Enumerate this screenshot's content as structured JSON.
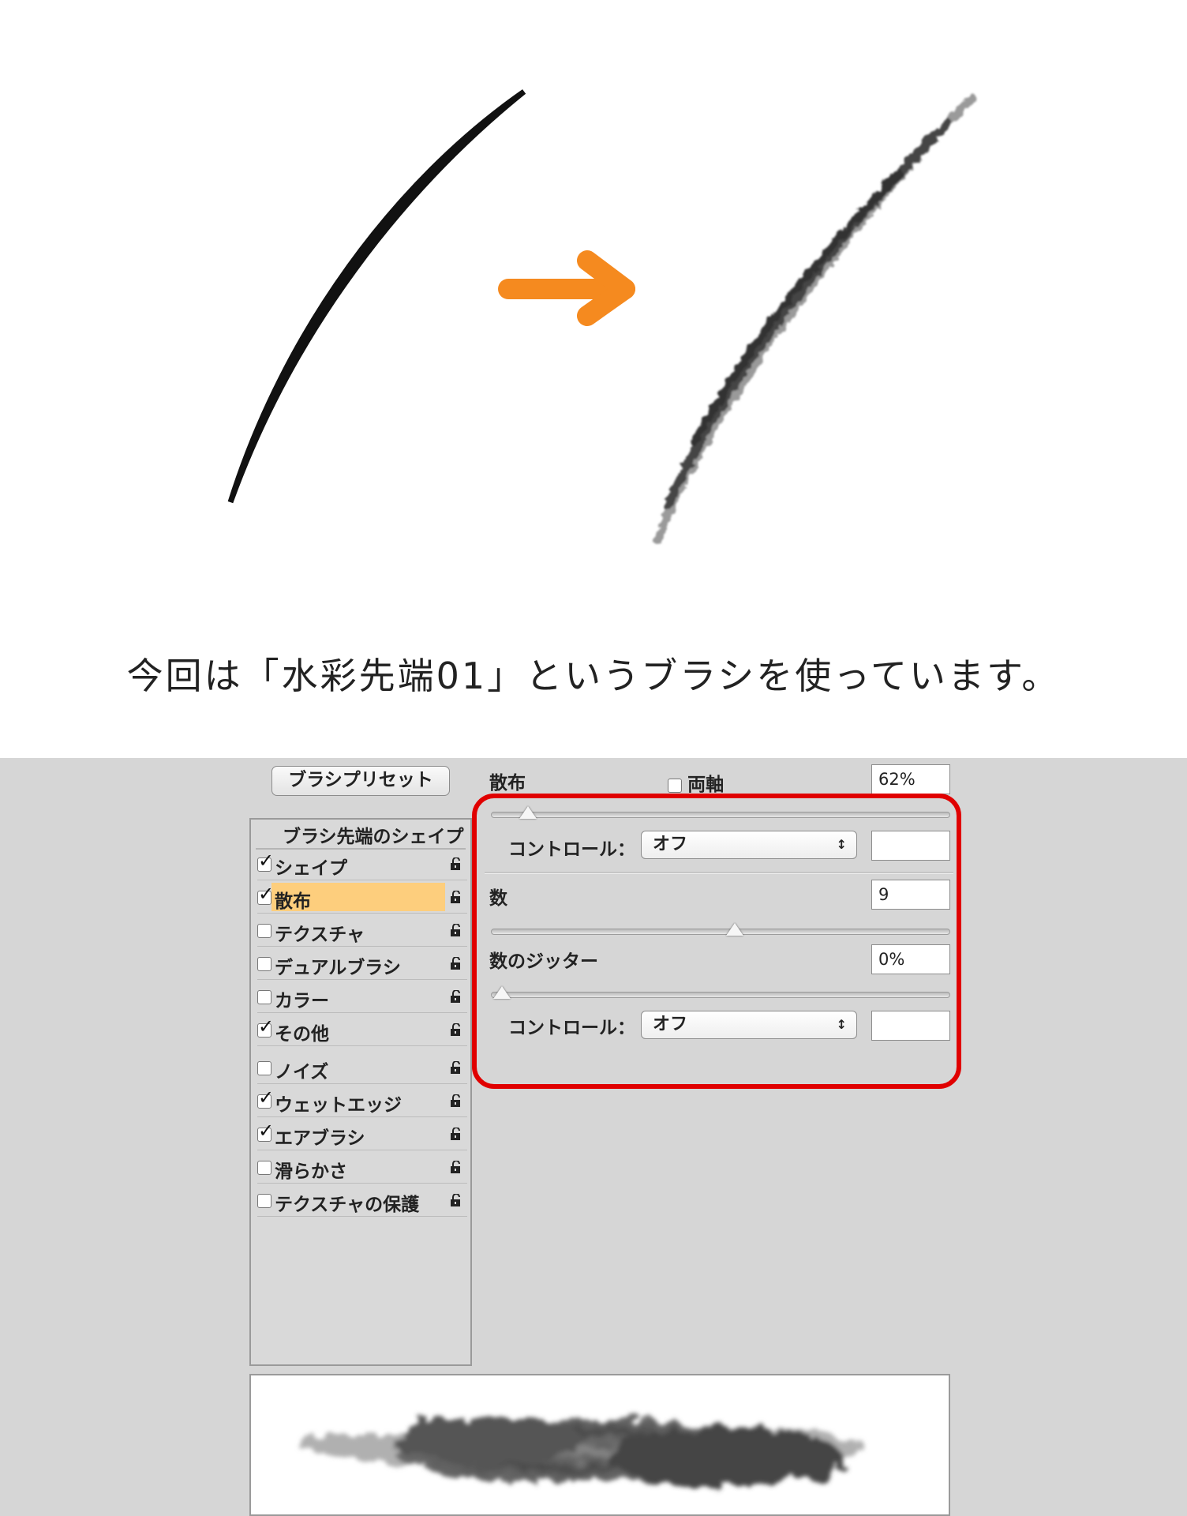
{
  "caption": "今回は「水彩先端01」というブラシを使っています。",
  "colors": {
    "arrow": "#f58a1f",
    "highlight": "#fdce7d",
    "callout": "#e00000",
    "panel_bg": "#d6d6d6"
  },
  "panel": {
    "preset_button": "ブラシプリセット",
    "list_header": "ブラシ先端のシェイプ",
    "items": [
      {
        "label": "シェイプ",
        "checked": true
      },
      {
        "label": "散布",
        "checked": true,
        "selected": true
      },
      {
        "label": "テクスチャ",
        "checked": false
      },
      {
        "label": "デュアルブラシ",
        "checked": false
      },
      {
        "label": "カラー",
        "checked": false
      },
      {
        "label": "その他",
        "checked": true
      },
      {
        "label": "ノイズ",
        "checked": false
      },
      {
        "label": "ウェットエッジ",
        "checked": true
      },
      {
        "label": "エアブラシ",
        "checked": true
      },
      {
        "label": "滑らかさ",
        "checked": false
      },
      {
        "label": "テクスチャの保護",
        "checked": false
      }
    ],
    "scatter": {
      "label": "散布",
      "both_axes_label": "両軸",
      "both_axes_checked": false,
      "value": "62%",
      "slider_fraction": 0.06
    },
    "control1": {
      "label": "コントロール：",
      "selected": "オフ",
      "value": ""
    },
    "count": {
      "label": "数",
      "value": "9",
      "slider_fraction": 0.53
    },
    "count_jitter": {
      "label": "数のジッター",
      "value": "0%",
      "slider_fraction": 0.0
    },
    "control2": {
      "label": "コントロール：",
      "selected": "オフ",
      "value": ""
    }
  }
}
